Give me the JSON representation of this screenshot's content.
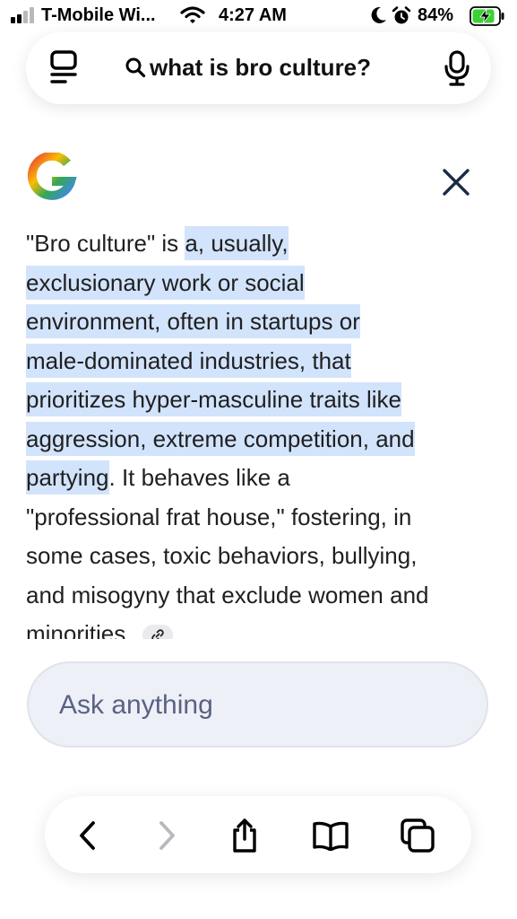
{
  "status_bar": {
    "carrier": "T-Mobile Wi...",
    "time": "4:27 AM",
    "battery_percent": "84%",
    "signal_bars_active": 2,
    "icons": [
      "signal-icon",
      "wifi-icon",
      "moon-icon",
      "alarm-icon",
      "battery-charging-icon"
    ]
  },
  "search_bar": {
    "query": "what is bro culture?",
    "icons": [
      "menu-icon",
      "search-icon",
      "mic-icon"
    ]
  },
  "ai_overview": {
    "logo": "google-logo",
    "text_before": "\"Bro culture\" is ",
    "highlight_lines": [
      "a, usually,",
      "exclusionary work or social",
      "environment, often in startups or",
      "male-dominated industries, that",
      "prioritizes hyper-masculine traits like",
      "aggression, extreme competition, and",
      "partying"
    ],
    "text_after_lines": [
      ". It behaves like a",
      "\"professional frat house,\" fostering, in",
      "some cases, toxic behaviors, bullying,",
      "and misogyny that exclude women and",
      "minorities."
    ],
    "highlight_color": "#d2e3fc"
  },
  "ask_box": {
    "placeholder": "Ask anything"
  },
  "toolbar": {
    "icons": [
      "back-icon",
      "forward-icon",
      "share-icon",
      "bookmarks-icon",
      "tabs-icon"
    ]
  }
}
